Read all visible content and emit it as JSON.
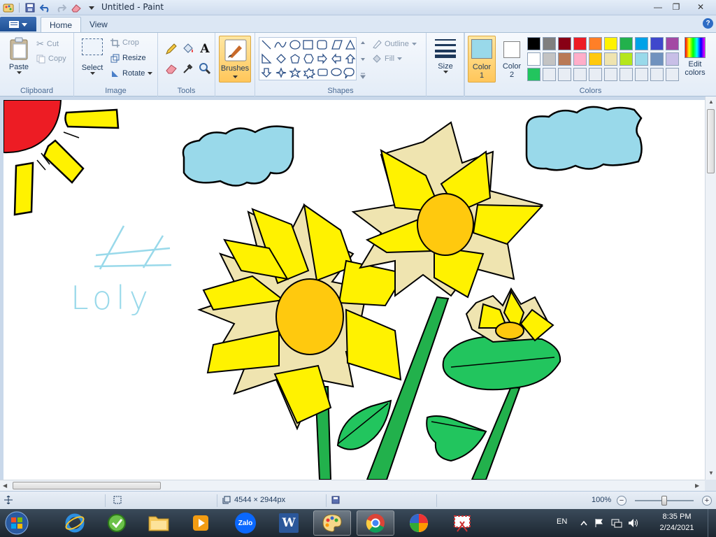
{
  "window": {
    "title": "Untitled - Paint",
    "minimize": "—",
    "maximize": "❐",
    "close": "✕"
  },
  "tabs": {
    "home": "Home",
    "view": "View"
  },
  "ribbon": {
    "clipboard": {
      "label": "Clipboard",
      "paste": "Paste",
      "cut": "Cut",
      "copy": "Copy"
    },
    "image": {
      "label": "Image",
      "select": "Select",
      "crop": "Crop",
      "resize": "Resize",
      "rotate": "Rotate"
    },
    "tools": {
      "label": "Tools",
      "text_tool": "A"
    },
    "brushes": "Brushes",
    "shapes": {
      "label": "Shapes",
      "outline": "Outline",
      "fill": "Fill"
    },
    "size": "Size",
    "colors": {
      "label": "Colors",
      "color1": "Color",
      "color1_num": "1",
      "color2": "Color",
      "color2_num": "2",
      "edit": "Edit colors",
      "color1_value": "#99d9ea",
      "color2_value": "#ffffff",
      "palette": [
        "#000000",
        "#7f7f7f",
        "#880015",
        "#ed1c24",
        "#ff7f27",
        "#fff200",
        "#22b14c",
        "#00a2e8",
        "#3f48cc",
        "#a349a4",
        "#ffffff",
        "#c3c3c3",
        "#b97a57",
        "#ffaec9",
        "#ffc90e",
        "#efe4b0",
        "#b5e61d",
        "#99d9ea",
        "#7092be",
        "#c8bfe7",
        "#22c55e",
        "#e8edf4",
        "#e8edf4",
        "#e8edf4",
        "#e8edf4",
        "#e8edf4",
        "#e8edf4",
        "#e8edf4",
        "#e8edf4",
        "#e8edf4"
      ]
    }
  },
  "canvas": {
    "handwriting_line1": "#",
    "handwriting_line2": "Loly"
  },
  "statusbar": {
    "dimensions": "4544 × 2944px",
    "zoom": "100%",
    "zoom_out": "−",
    "zoom_in": "+"
  },
  "taskbar": {
    "apps": [
      "internet-explorer",
      "browser-green",
      "file-explorer",
      "media-player",
      "zalo",
      "word",
      "paint",
      "chrome",
      "color-app",
      "snipping-tool"
    ],
    "zalo_label": "Zalo",
    "word_label": "W",
    "language": "EN",
    "time": "8:35 PM",
    "date": "2/24/2021"
  }
}
